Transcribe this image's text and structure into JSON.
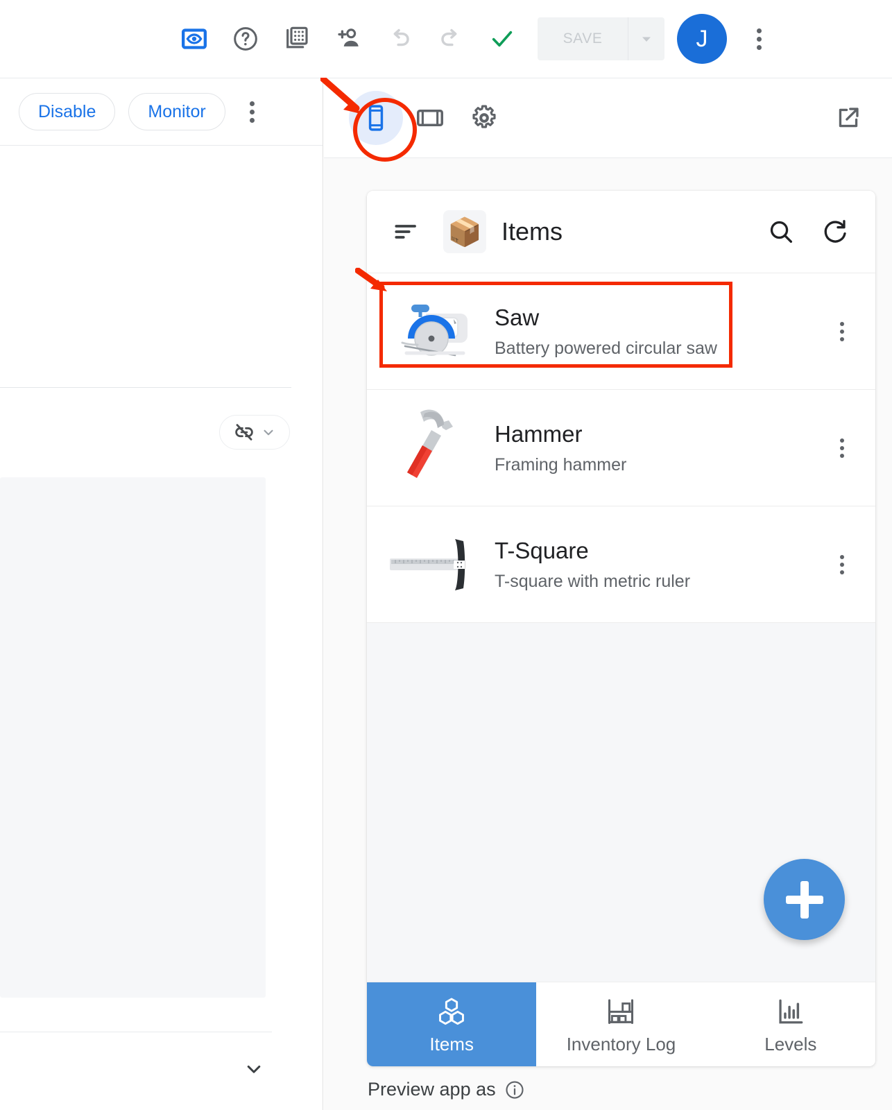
{
  "topbar": {
    "icons": [
      {
        "name": "preview-eye-icon",
        "label": "Preview"
      },
      {
        "name": "help-icon",
        "label": "Help"
      },
      {
        "name": "screens-grid-icon",
        "label": "Screens"
      },
      {
        "name": "add-person-icon",
        "label": "Share"
      },
      {
        "name": "undo-icon",
        "label": "Undo"
      },
      {
        "name": "redo-icon",
        "label": "Redo"
      },
      {
        "name": "check-icon",
        "label": "Saved"
      }
    ],
    "save_label": "SAVE",
    "avatar_initial": "J",
    "overflow_label": "More options"
  },
  "left_panel": {
    "disable_label": "Disable",
    "monitor_label": "Monitor",
    "overflow_label": "More",
    "linkoff_label": "Unlinked"
  },
  "preview_toolbar": {
    "devices": [
      {
        "name": "phone-icon",
        "label": "Phone",
        "active": true
      },
      {
        "name": "tablet-icon",
        "label": "Tablet",
        "active": false
      },
      {
        "name": "settings-gear-icon",
        "label": "Settings",
        "active": false
      }
    ],
    "open_in_new_label": "Open in new window"
  },
  "app": {
    "title": "Items",
    "logo_emoji": "📦",
    "menu_label": "Menu",
    "search_label": "Search",
    "refresh_label": "Refresh",
    "items": [
      {
        "title": "Saw",
        "subtitle": "Battery powered circular saw",
        "thumb": "circular-saw-illustration",
        "highlighted": true
      },
      {
        "title": "Hammer",
        "subtitle": "Framing hammer",
        "thumb": "hammer-illustration",
        "highlighted": false
      },
      {
        "title": "T-Square",
        "subtitle": "T-square with metric ruler",
        "thumb": "t-square-illustration",
        "highlighted": false
      }
    ],
    "fab_label": "Add item",
    "bottom_nav": [
      {
        "label": "Items",
        "icon": "cubes-icon",
        "active": true
      },
      {
        "label": "Inventory Log",
        "icon": "shelf-icon",
        "active": false
      },
      {
        "label": "Levels",
        "icon": "bar-chart-icon",
        "active": false
      }
    ]
  },
  "footer": {
    "preview_as_label": "Preview app as",
    "info_label": "Info"
  },
  "colors": {
    "accent_blue": "#1a73e8",
    "app_blue": "#4a90d9",
    "annotation_red": "#f42a00",
    "green_check": "#0f9d58",
    "disabled_gray": "#f1f3f4"
  }
}
